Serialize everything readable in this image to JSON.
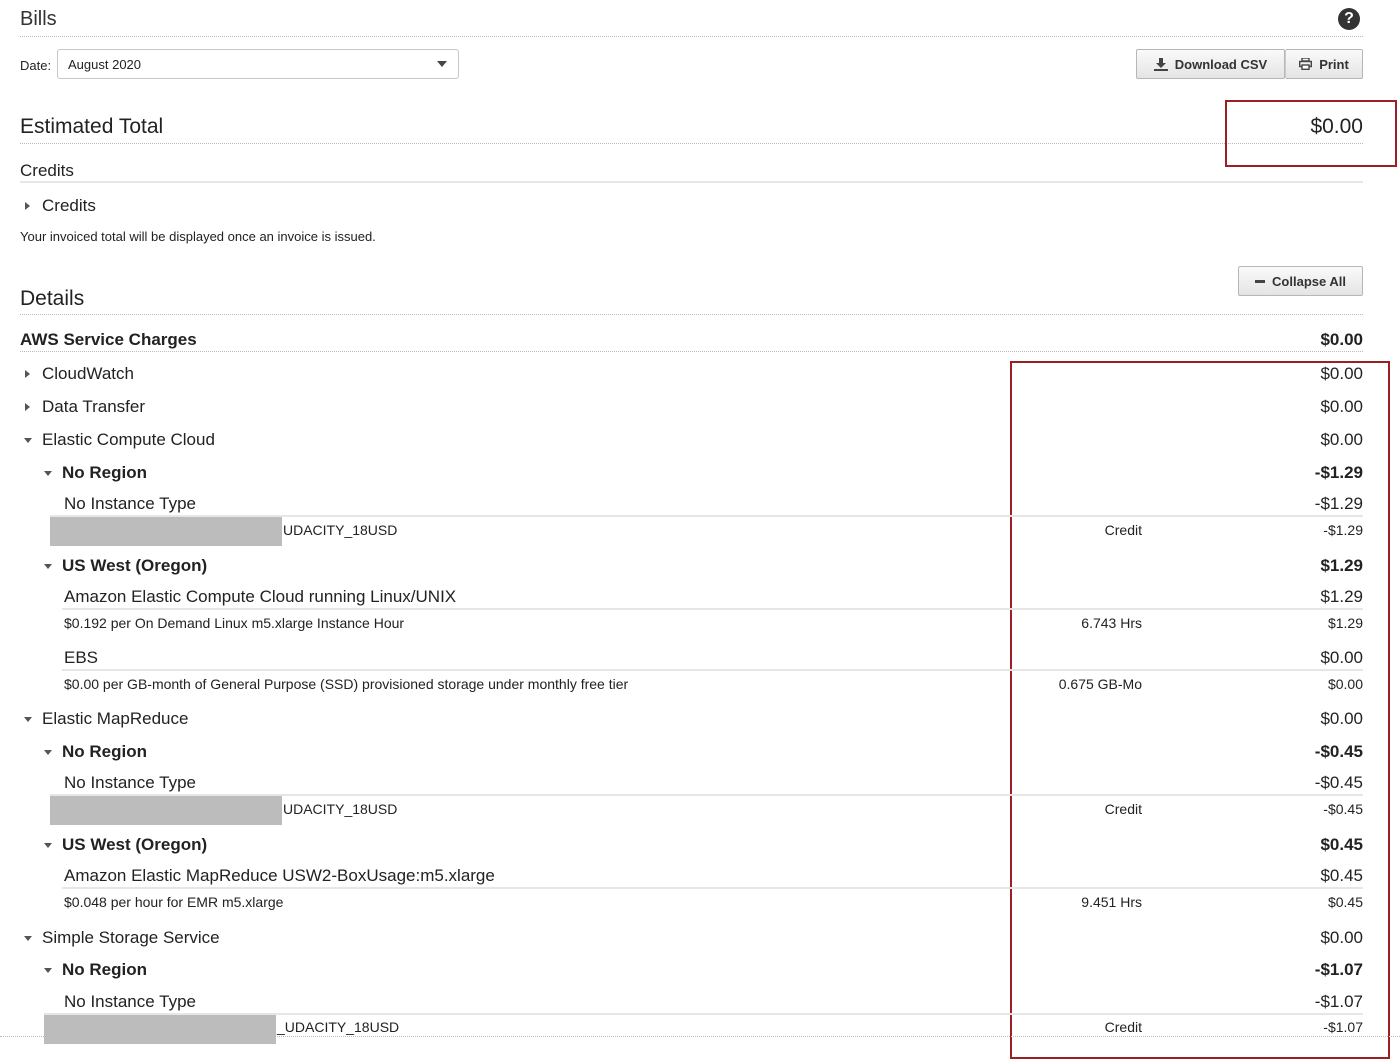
{
  "header": {
    "title": "Bills",
    "help_icon": "question-circle-icon"
  },
  "date": {
    "label": "Date:",
    "selected": "August 2020"
  },
  "toolbar": {
    "download_label": "Download CSV",
    "print_label": "Print"
  },
  "estimated": {
    "title": "Estimated Total",
    "amount": "$0.00"
  },
  "credits": {
    "section": "Credits",
    "item": "Credits",
    "note": "Your invoiced total will be displayed once an invoice is issued."
  },
  "details": {
    "title": "Details",
    "collapse_label": "Collapse All"
  },
  "aws": {
    "label": "AWS Service Charges",
    "amount": "$0.00"
  },
  "services": {
    "cloudwatch": {
      "label": "CloudWatch",
      "amount": "$0.00"
    },
    "datatransfer": {
      "label": "Data Transfer",
      "amount": "$0.00"
    },
    "ec2": {
      "label": "Elastic Compute Cloud",
      "amount": "$0.00",
      "noregion": {
        "label": "No Region",
        "amount": "-$1.29",
        "type": {
          "label": "No Instance Type",
          "amount": "-$1.29"
        },
        "line": {
          "label": "UDACITY_18USD",
          "qty": "Credit",
          "amount": "-$1.29"
        }
      },
      "uswest": {
        "label": "US West (Oregon)",
        "amount": "$1.29",
        "linux": {
          "label": "Amazon Elastic Compute Cloud running Linux/UNIX",
          "amount": "$1.29"
        },
        "linux_line": {
          "label": "$0.192 per On Demand Linux m5.xlarge Instance Hour",
          "qty": "6.743 Hrs",
          "amount": "$1.29"
        },
        "ebs": {
          "label": "EBS",
          "amount": "$0.00"
        },
        "ebs_line": {
          "label": "$0.00 per GB-month of General Purpose (SSD) provisioned storage under monthly free tier",
          "qty": "0.675 GB-Mo",
          "amount": "$0.00"
        }
      }
    },
    "emr": {
      "label": "Elastic MapReduce",
      "amount": "$0.00",
      "noregion": {
        "label": "No Region",
        "amount": "-$0.45",
        "type": {
          "label": "No Instance Type",
          "amount": "-$0.45"
        },
        "line": {
          "label": "UDACITY_18USD",
          "qty": "Credit",
          "amount": "-$0.45"
        }
      },
      "uswest": {
        "label": "US West (Oregon)",
        "amount": "$0.45",
        "box": {
          "label": "Amazon Elastic MapReduce USW2-BoxUsage:m5.xlarge",
          "amount": "$0.45"
        },
        "box_line": {
          "label": "$0.048 per hour for EMR m5.xlarge",
          "qty": "9.451 Hrs",
          "amount": "$0.45"
        }
      }
    },
    "s3": {
      "label": "Simple Storage Service",
      "amount": "$0.00",
      "noregion": {
        "label": "No Region",
        "amount": "-$1.07",
        "type": {
          "label": "No Instance Type",
          "amount": "-$1.07"
        },
        "line": {
          "label": "_UDACITY_18USD",
          "qty": "Credit",
          "amount": "-$1.07"
        }
      }
    }
  },
  "colors": {
    "highlight": "#9c1f24",
    "redacted": "#bcbcbc"
  }
}
